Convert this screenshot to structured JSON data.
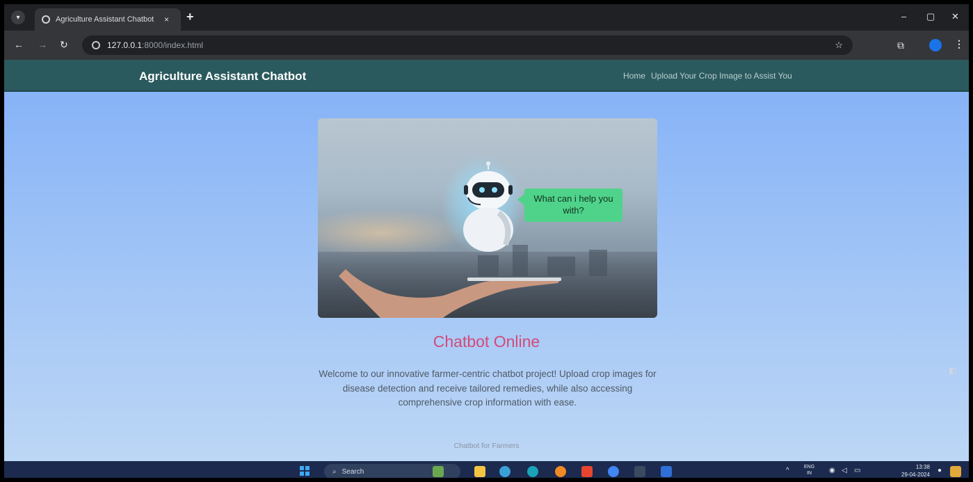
{
  "browser": {
    "tab_title": "Agriculture Assistant Chatbot",
    "tab_close": "×",
    "new_tab": "+",
    "url_host": "127.0.0.1",
    "url_rest": ":8000/index.html",
    "window_controls": [
      "–",
      "▢",
      "✕"
    ]
  },
  "navbar": {
    "brand": "Agriculture Assistant Chatbot",
    "links": [
      "Home",
      "Upload Your Crop Image to Assist You"
    ]
  },
  "hero": {
    "bubble_text": "What can i help you with?"
  },
  "main": {
    "title": "Chatbot Online",
    "description": "Welcome to our innovative farmer-centric chatbot project! Upload crop images for disease detection and receive tailored remedies, while also accessing comprehensive crop information with ease.",
    "footer": "Chatbot for Farmers"
  },
  "taskbar": {
    "search_label": "Search",
    "lang_top": "ENG",
    "lang_bottom": "IN",
    "time": "13:38",
    "date": "29-04-2024"
  },
  "colors": {
    "navbar": "#2b5a5e",
    "title": "#d24b7a",
    "bubble": "#4fd38a",
    "page_top": "#82b0f7"
  }
}
